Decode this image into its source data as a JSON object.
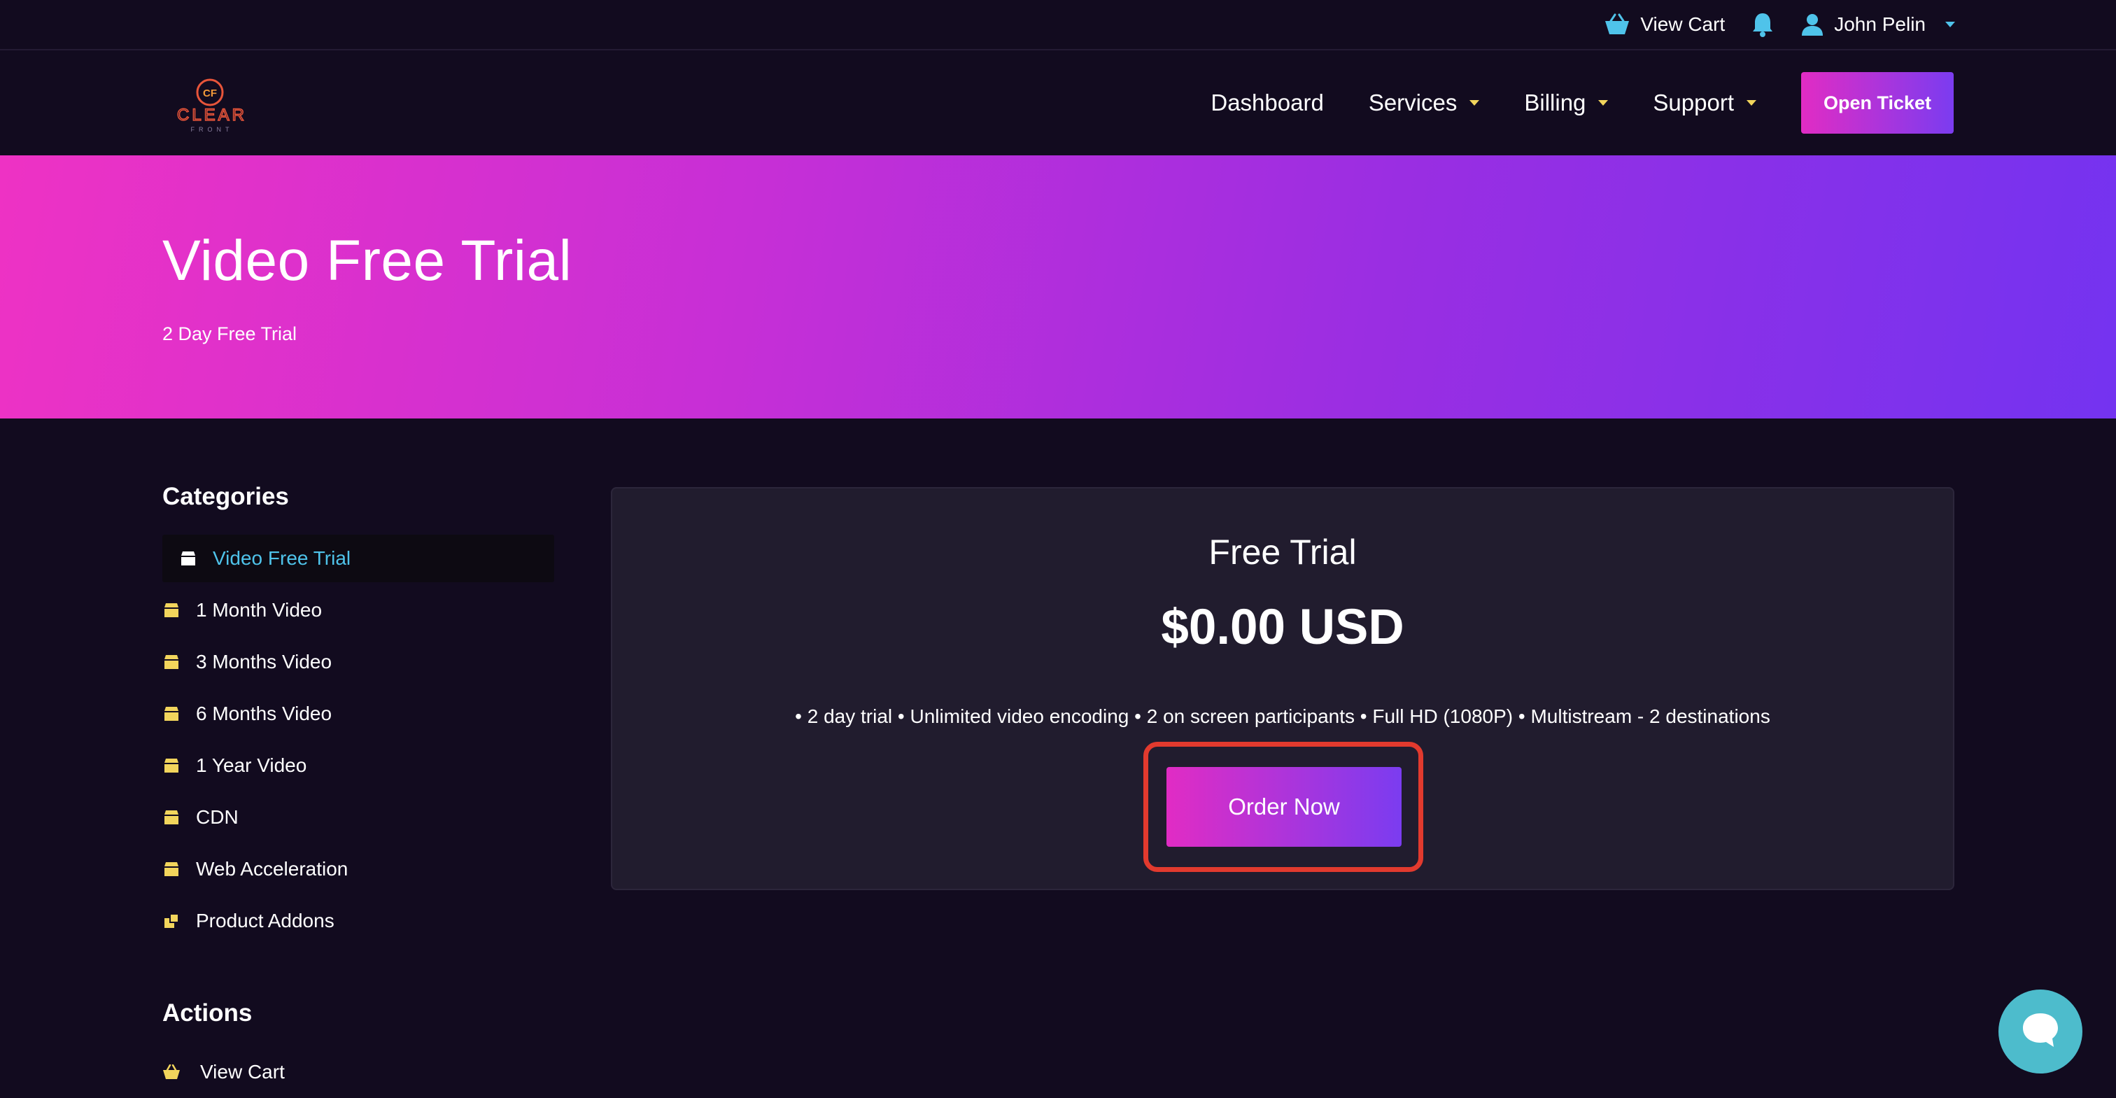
{
  "topbar": {
    "view_cart": "View Cart",
    "user_name": "John Pelin"
  },
  "logo": {
    "label": "CLEAR",
    "sublabel": "FRONT",
    "badge": "CF"
  },
  "nav": {
    "dashboard": "Dashboard",
    "services": "Services",
    "billing": "Billing",
    "support": "Support",
    "open_ticket": "Open Ticket"
  },
  "hero": {
    "title": "Video Free Trial",
    "subtitle": "2 Day Free Trial"
  },
  "sidebar": {
    "categories_heading": "Categories",
    "categories": [
      {
        "label": "Video Free Trial",
        "icon": "box-icon",
        "active": true
      },
      {
        "label": "1 Month Video",
        "icon": "box-icon"
      },
      {
        "label": "3 Months Video",
        "icon": "box-icon"
      },
      {
        "label": "6 Months Video",
        "icon": "box-icon"
      },
      {
        "label": "1 Year Video",
        "icon": "box-icon"
      },
      {
        "label": "CDN",
        "icon": "box-icon"
      },
      {
        "label": "Web Acceleration",
        "icon": "box-icon"
      },
      {
        "label": "Product Addons",
        "icon": "addons-icon"
      }
    ],
    "actions_heading": "Actions",
    "actions": [
      {
        "label": "View Cart",
        "icon": "basket-icon"
      }
    ]
  },
  "product": {
    "name": "Free Trial",
    "price": "$0.00 USD",
    "features": "• 2 day trial • Unlimited video encoding • 2 on screen participants • Full HD (1080P) • Multistream - 2 destinations",
    "order_label": "Order Now"
  },
  "colors": {
    "background": "#120b1f",
    "accent_blue": "#4fc3ea",
    "icon_yellow": "#f2d55c",
    "gradient_start": "#e12cc4",
    "gradient_end": "#7b3cf0",
    "highlight_red": "#e23a2e",
    "chat_teal": "#4dbccc"
  }
}
